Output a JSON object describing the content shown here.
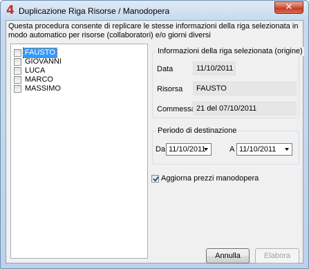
{
  "window": {
    "title": "Duplicazione Riga Risorse / Manodopera",
    "app_icon": "4",
    "close_glyph": "✕"
  },
  "intro_text": "Questa procedura consente di replicare le stesse informazioni della riga selezionata in modo automatico per risorse (collaboratori) e/o giorni diversi",
  "resource_list": [
    {
      "label": "FAUSTO",
      "checked": false,
      "selected": true
    },
    {
      "label": "GIOVANNI",
      "checked": false,
      "selected": false
    },
    {
      "label": "LUCA",
      "checked": false,
      "selected": false
    },
    {
      "label": "MARCO",
      "checked": false,
      "selected": false
    },
    {
      "label": "MASSIMO",
      "checked": false,
      "selected": false
    }
  ],
  "origin_group": {
    "legend": "Informazioni della riga selezionata (origine)",
    "data_label": "Data",
    "data_value": "11/10/2011",
    "risorsa_label": "Risorsa",
    "risorsa_value": "FAUSTO",
    "commessa_label": "Commessa",
    "commessa_value": "21 del 07/10/2011"
  },
  "period_group": {
    "legend": "Periodo di destinazione",
    "da_label": "Da",
    "da_value": "11/10/2011",
    "a_label": "A",
    "a_value": "11/10/2011"
  },
  "update_prices": {
    "label": "Aggiorna prezzi manodopera",
    "checked": true
  },
  "buttons": {
    "cancel": "Annulla",
    "process": "Elabora"
  }
}
